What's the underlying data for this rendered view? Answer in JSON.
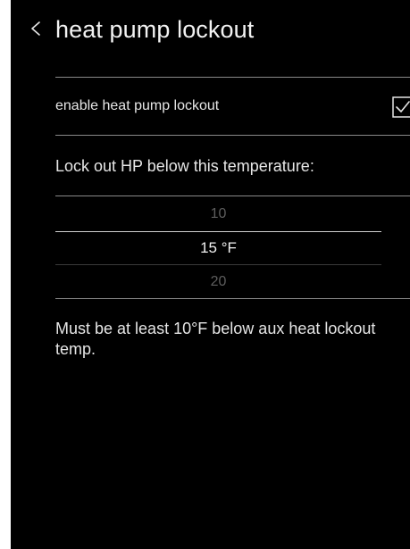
{
  "header": {
    "back_icon": "chevron-left-icon",
    "title": "heat pump lockout"
  },
  "settings": {
    "enable_label": "enable heat pump lockout",
    "enable_checked": true,
    "checkbox_icon": "checkbox-checked-icon"
  },
  "temperature": {
    "prompt": "Lock out HP below this temperature:",
    "options": [
      "10",
      "15 °F",
      "20"
    ],
    "selected_index": 1
  },
  "note": "Must be at least 10°F below aux heat lockout temp.",
  "colors": {
    "background": "#000000",
    "text": "#e6e6e6",
    "muted_text": "#5e5e5e",
    "divider": "#8a8a8a"
  }
}
